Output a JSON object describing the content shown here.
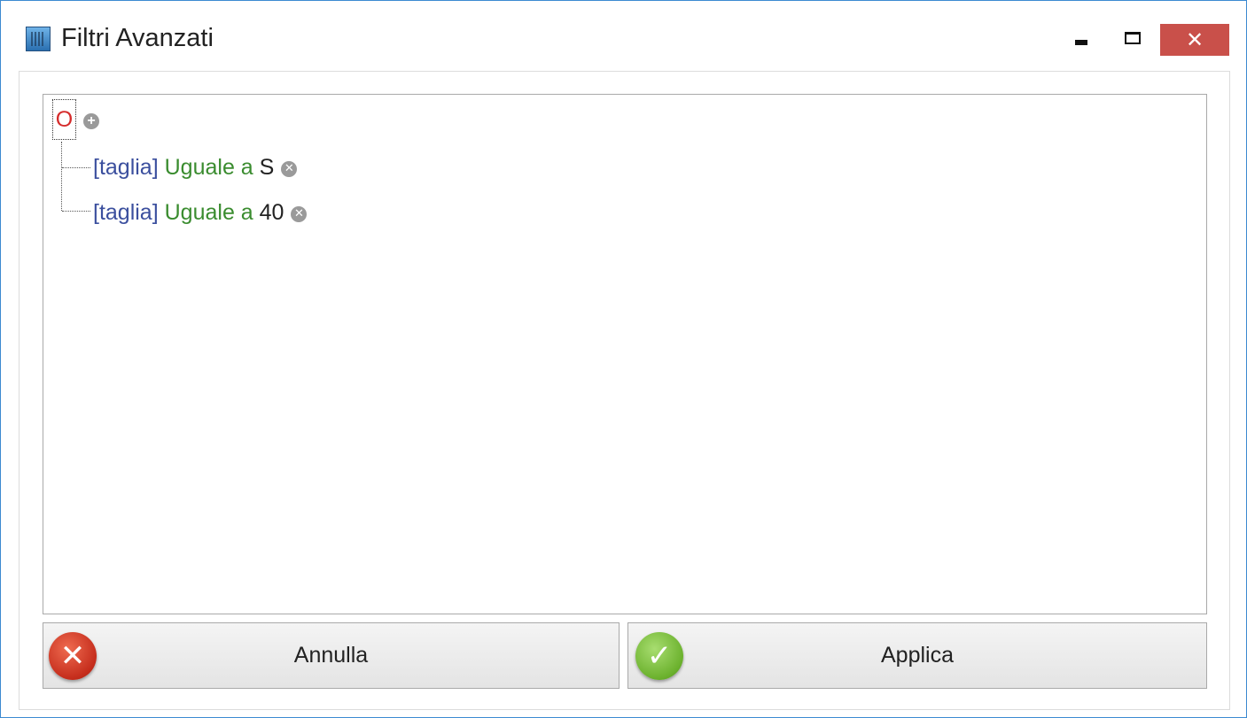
{
  "window": {
    "title": "Filtri Avanzati",
    "close_glyph": "✕",
    "accent_color": "#3c8ad1",
    "close_color": "#c9504a"
  },
  "tree": {
    "group_operator": "O",
    "add_glyph": "+",
    "remove_glyph": "✕",
    "conditions": [
      {
        "field": "[taglia]",
        "operator": "Uguale a",
        "value": "S"
      },
      {
        "field": "[taglia]",
        "operator": "Uguale a",
        "value": "40"
      }
    ]
  },
  "buttons": {
    "cancel_label": "Annulla",
    "apply_label": "Applica",
    "cancel_glyph": "✕",
    "apply_glyph": "✓"
  },
  "icons": {
    "app": "filter-app-icon",
    "add": "plus-circle-icon",
    "remove": "x-circle-icon",
    "cancel": "red-x-circle-icon",
    "apply": "green-check-circle-icon"
  }
}
